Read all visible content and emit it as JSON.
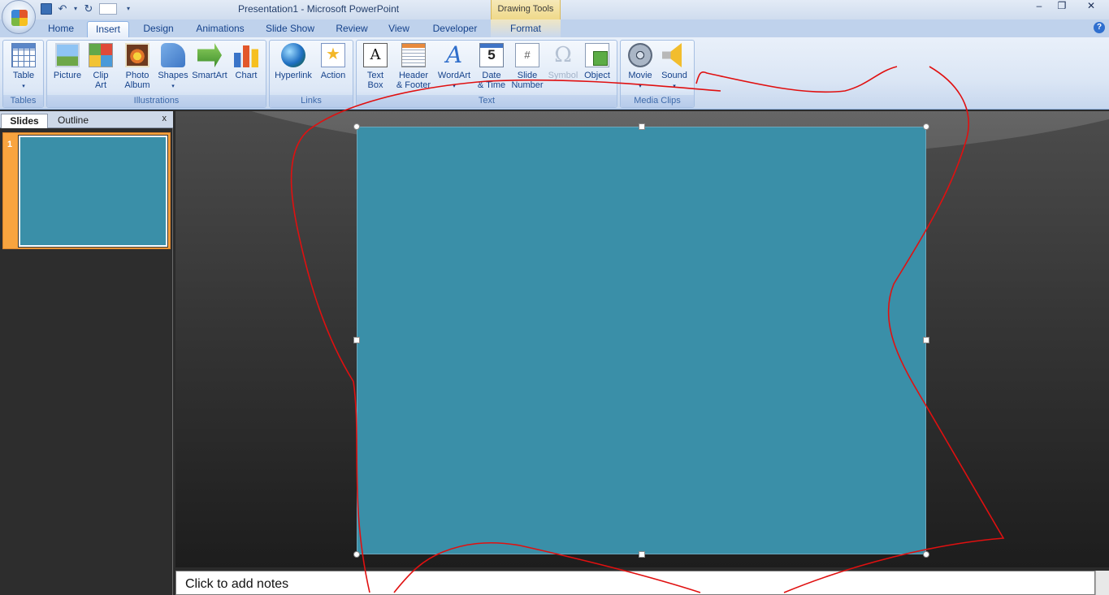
{
  "window": {
    "title": "Presentation1 - Microsoft PowerPoint",
    "contextual_group": "Drawing Tools",
    "minimize": "–",
    "restore": "❐",
    "close": "✕"
  },
  "quick_access": {
    "undo": "↶",
    "dropdown": "▾",
    "redo": "↻"
  },
  "tabs": [
    "Home",
    "Insert",
    "Design",
    "Animations",
    "Slide Show",
    "Review",
    "View",
    "Developer",
    "Format"
  ],
  "active_tab": "Insert",
  "help": "?",
  "ribbon": {
    "groups": {
      "tables": "Tables",
      "illustrations": "Illustrations",
      "links": "Links",
      "text": "Text",
      "media": "Media Clips"
    },
    "commands": {
      "table": "Table",
      "picture": "Picture",
      "clip_art": "Clip\nArt",
      "photo_album": "Photo\nAlbum",
      "shapes": "Shapes",
      "smartart": "SmartArt",
      "chart": "Chart",
      "hyperlink": "Hyperlink",
      "action": "Action",
      "text_box": "Text\nBox",
      "header_footer": "Header\n& Footer",
      "wordart": "WordArt",
      "date_time": "Date\n& Time",
      "slide_number": "Slide\nNumber",
      "symbol": "Symbol",
      "object": "Object",
      "movie": "Movie",
      "sound": "Sound"
    },
    "icon_text": {
      "text_box": "A",
      "wordart": "A",
      "date_time": "5",
      "slide_number": "#",
      "symbol": "Ω"
    },
    "arrow": "▾"
  },
  "panel": {
    "tab_slides": "Slides",
    "tab_outline": "Outline",
    "close": "x",
    "slide_number": "1"
  },
  "notes": {
    "placeholder": "Click to add notes"
  },
  "colors": {
    "slide_fill": "#3a8fa8",
    "annotation": "#e01010",
    "thumbnail_highlight": "#f9a43f"
  }
}
